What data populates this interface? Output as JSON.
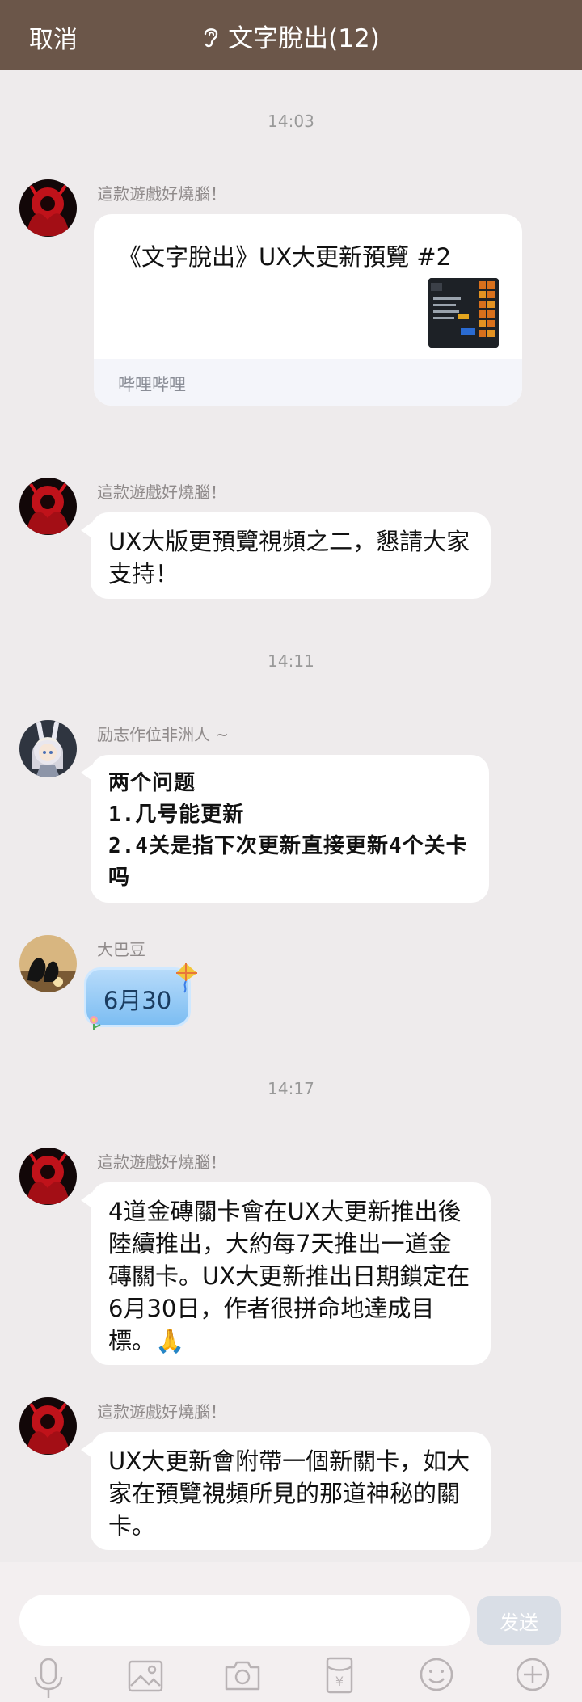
{
  "header": {
    "cancel": "取消",
    "title": "文字脫出(12)"
  },
  "timestamps": [
    "14:03",
    "14:11",
    "14:17"
  ],
  "messages": [
    {
      "sender": "這款遊戲好燒腦！",
      "card_title": "《文字脫出》UX大更新預覽 #2",
      "card_source": "哔哩哔哩"
    },
    {
      "sender": "這款遊戲好燒腦！",
      "text": "UX大版更預覽視頻之二，懇請大家支持！"
    },
    {
      "sender": "励志作位非洲人 ~",
      "text": "两个问题\n1.几号能更新\n2.4关是指下次更新直接更新4个关卡吗"
    },
    {
      "sender": "大巴豆",
      "sticker_text": "6月30"
    },
    {
      "sender": "這款遊戲好燒腦！",
      "text": "4道金磚關卡會在UX大更新推出後陸續推出，大約每7天推出一道金磚關卡。UX大更新推出日期鎖定在6月30日，作者很拼命地達成目標。🙏"
    },
    {
      "sender": "這款遊戲好燒腦！",
      "text": "UX大更新會附帶一個新關卡，如大家在預覽視頻所見的那道神秘的關卡。"
    }
  ],
  "composer": {
    "placeholder": "",
    "send_label": "发送"
  },
  "toolbar": [
    "mic-icon",
    "image-icon",
    "camera-icon",
    "red-packet-icon",
    "emoji-icon",
    "plus-icon"
  ],
  "colors": {
    "header_bg": "#6b5649",
    "chat_bg": "#eeebec",
    "bubble_bg": "#ffffff"
  }
}
